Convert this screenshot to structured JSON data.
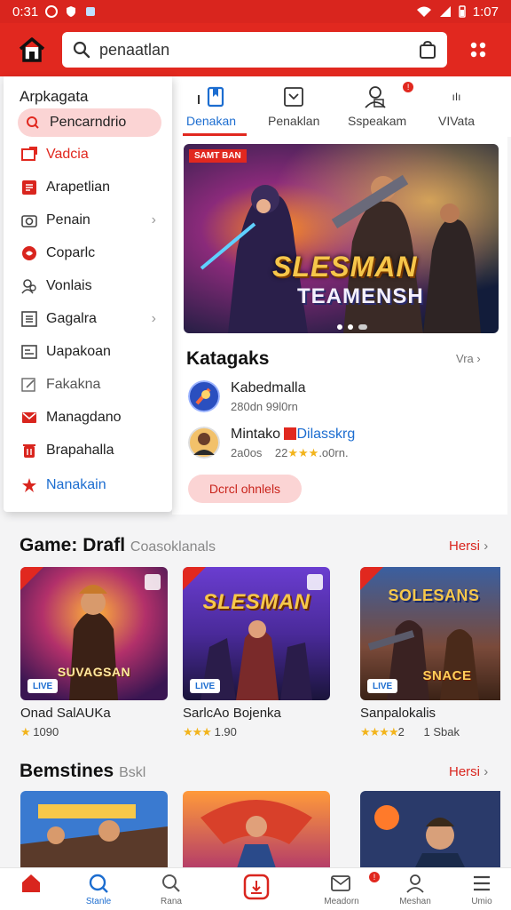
{
  "status_bar": {
    "time": "0:31",
    "battery": "1:07"
  },
  "search": {
    "value": "penaatlan"
  },
  "drawer": {
    "title": "Arpkagata",
    "items": [
      {
        "label": "Pencarndrio",
        "icon": "search-icon",
        "active": true
      },
      {
        "label": "Vadcia",
        "icon": "tag-icon"
      },
      {
        "label": "Arapetlian",
        "icon": "list-icon"
      },
      {
        "label": "Penain",
        "icon": "camera-icon",
        "chevron": true
      },
      {
        "label": "Coparlc",
        "icon": "circle-icon"
      },
      {
        "label": "Vonlais",
        "icon": "people-icon"
      },
      {
        "label": "Gagalra",
        "icon": "grid-icon",
        "chevron": true
      },
      {
        "label": "Uapakoan",
        "icon": "doc-icon"
      },
      {
        "label": "Fakakna",
        "icon": "edit-icon"
      },
      {
        "label": "Managdano",
        "icon": "mail-icon"
      },
      {
        "label": "Brapahalla",
        "icon": "trash-icon"
      },
      {
        "label": "Nanakain",
        "icon": "star-icon"
      }
    ]
  },
  "tabs": [
    {
      "label": "Denakan",
      "icon": "bookmark-icon",
      "active": true
    },
    {
      "label": "Penaklan",
      "icon": "download-icon"
    },
    {
      "label": "Sspeakam",
      "icon": "user-icon",
      "badge": "!"
    },
    {
      "label": "VIVata",
      "icon": "tab-icon"
    }
  ],
  "banner": {
    "tag": "SAMT BAN",
    "title_line1": "SLESMAN",
    "title_line2": "TEAMENSH"
  },
  "katagaks": {
    "title": "Katagaks",
    "more": "Vra",
    "items": [
      {
        "name": "Kabedmalla",
        "meta": "280dn     99l0rn"
      },
      {
        "name": "Mintako",
        "name_tag": "Dilasskrg",
        "meta_left": "2a0os",
        "meta_mid": "22",
        "stars": "★★★",
        "meta_right": ".o0rn."
      }
    ],
    "button": "Dcrcl ohnlels"
  },
  "section1": {
    "title": "Game: Drafl",
    "subtitle": "Coasoklanals",
    "more": "Hersi",
    "cards": [
      {
        "logo": "SUVAGSAN",
        "badge": "LIVE",
        "name": "Onad SalAUKa",
        "stars": "★",
        "rating": "1090"
      },
      {
        "logo": "SLESMAN",
        "badge": "LIVE",
        "name": "SarlcAo Bojenka",
        "stars": "★★★",
        "rating": "1.90"
      },
      {
        "logo": "SOLESANS",
        "logo2": "SNACE",
        "badge": "LIVE",
        "name": "Sanpalokalis",
        "stars": "★★★★",
        "rating": "2",
        "extra": "1 Sbak"
      }
    ]
  },
  "section2": {
    "title": "Bemstines",
    "subtitle": "Bskl",
    "more": "Hersi"
  },
  "bottom_nav": [
    {
      "label": "",
      "icon": "home-icon"
    },
    {
      "label": "Stanle",
      "icon": "globe-icon",
      "active": true
    },
    {
      "label": "Rana",
      "icon": "search-icon"
    },
    {
      "label": "",
      "icon": "center-icon"
    },
    {
      "label": "Meadorn",
      "icon": "inbox-icon",
      "badge": "!"
    },
    {
      "label": "Meshan",
      "icon": "user-icon"
    },
    {
      "label": "Umio",
      "icon": "menu-icon"
    }
  ],
  "colors": {
    "brand_red": "#e1281f",
    "accent_blue": "#1c6dd0",
    "pill_pink": "#fbd4d4",
    "star_gold": "#f2b41c"
  }
}
